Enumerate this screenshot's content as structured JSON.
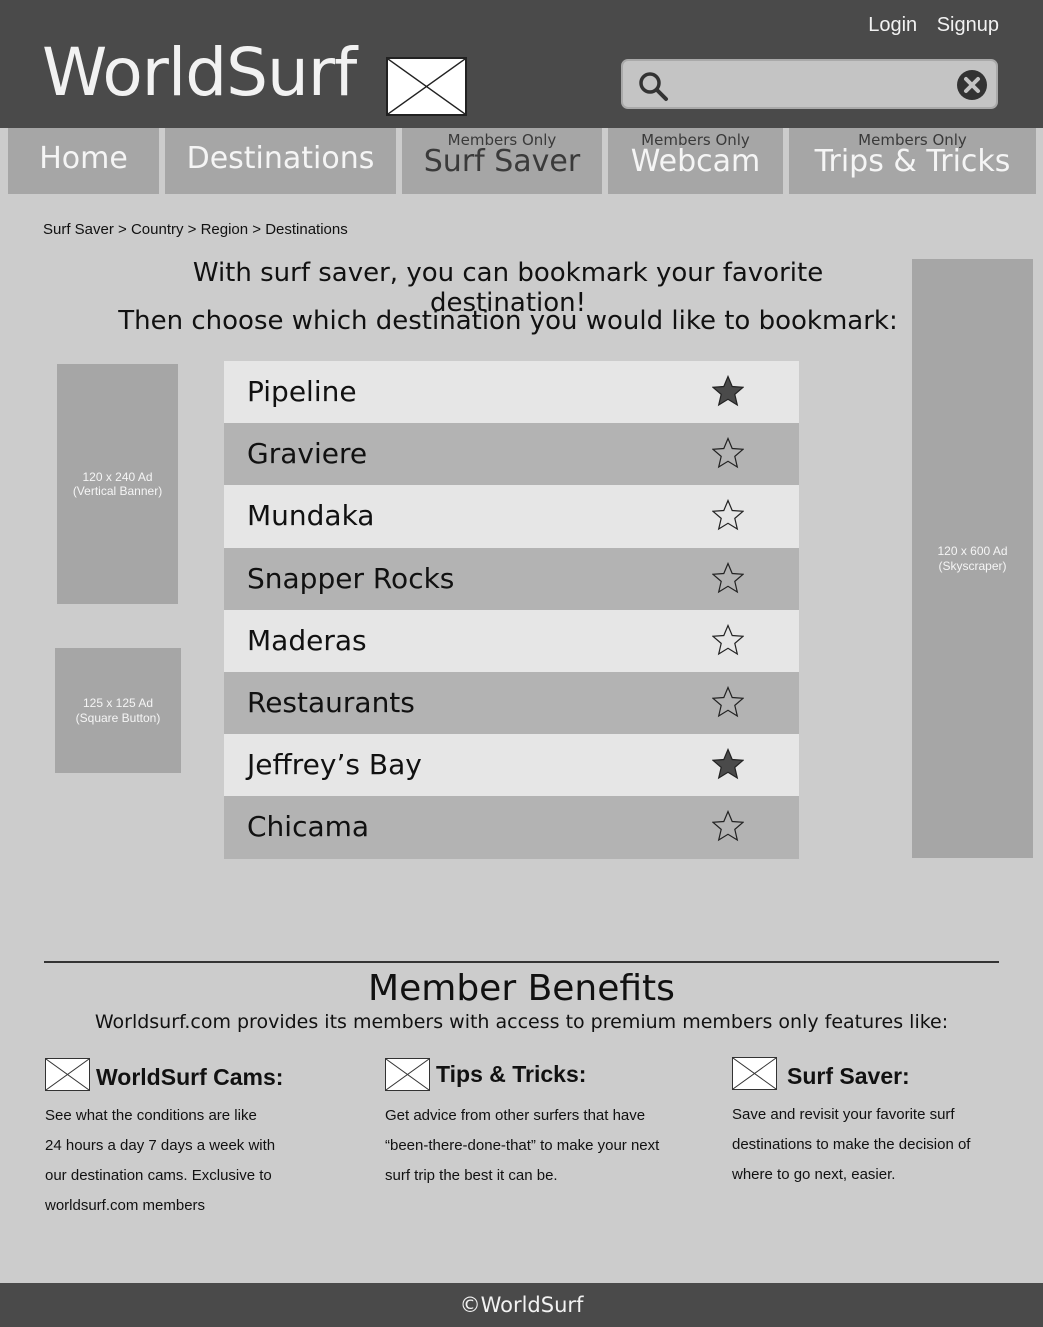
{
  "header": {
    "logo": "WorldSurf",
    "login": "Login",
    "signup": "Signup",
    "search_value": "",
    "search_icon": "search-icon",
    "clear_icon": "clear-icon"
  },
  "nav": {
    "tabs": [
      {
        "label": "Home",
        "sub": ""
      },
      {
        "label": "Destinations",
        "sub": ""
      },
      {
        "label": "Surf Saver",
        "sub": "Members Only"
      },
      {
        "label": "Webcam",
        "sub": "Members Only"
      },
      {
        "label": "Trips & Tricks",
        "sub": "Members Only"
      }
    ]
  },
  "breadcrumb": "Surf Saver > Country > Region > Destinations",
  "intro": {
    "line1": "With surf saver, you can bookmark your favorite destination!",
    "line2": "Then choose which destination you would like to bookmark:"
  },
  "ads": {
    "vertical_banner": [
      "120 x 240 Ad",
      "(Vertical Banner)"
    ],
    "square_button": [
      "125 x 125 Ad",
      "(Square Button)"
    ],
    "skyscraper": [
      "120 x 600 Ad",
      "(Skyscraper)"
    ]
  },
  "destinations": [
    {
      "name": "Pipeline",
      "bookmarked": true
    },
    {
      "name": "Graviere",
      "bookmarked": false
    },
    {
      "name": "Mundaka",
      "bookmarked": false
    },
    {
      "name": "Snapper Rocks",
      "bookmarked": false
    },
    {
      "name": "Maderas",
      "bookmarked": false
    },
    {
      "name": "Restaurants",
      "bookmarked": false
    },
    {
      "name": "Jeffrey’s Bay",
      "bookmarked": true
    },
    {
      "name": "Chicama",
      "bookmarked": false
    }
  ],
  "member_benefits": {
    "title": "Member Benefits",
    "subtitle": "Worldsurf.com provides its members with access to premium members only features like:",
    "items": [
      {
        "title": "WorldSurf Cams:",
        "lines": [
          "See what the conditions are like",
          "24 hours a day 7 days a week with",
          "our destination cams. Exclusive to",
          "worldsurf.com members"
        ]
      },
      {
        "title": "Tips & Tricks:",
        "lines": [
          "Get advice from other surfers that have",
          "“been-there-done-that” to make your next",
          "surf trip the best it can be."
        ]
      },
      {
        "title": "Surf Saver:",
        "lines": [
          "Save and revisit your favorite surf",
          "destinations to make the decision of",
          "where to go next, easier."
        ]
      }
    ]
  },
  "footer": "©WorldSurf",
  "colors": {
    "header_bg": "#4a4a4a",
    "page_bg": "#cccccc",
    "tab_bg": "#a6a6a6",
    "row_light": "#e6e6e6",
    "row_dark": "#b3b3b3"
  }
}
